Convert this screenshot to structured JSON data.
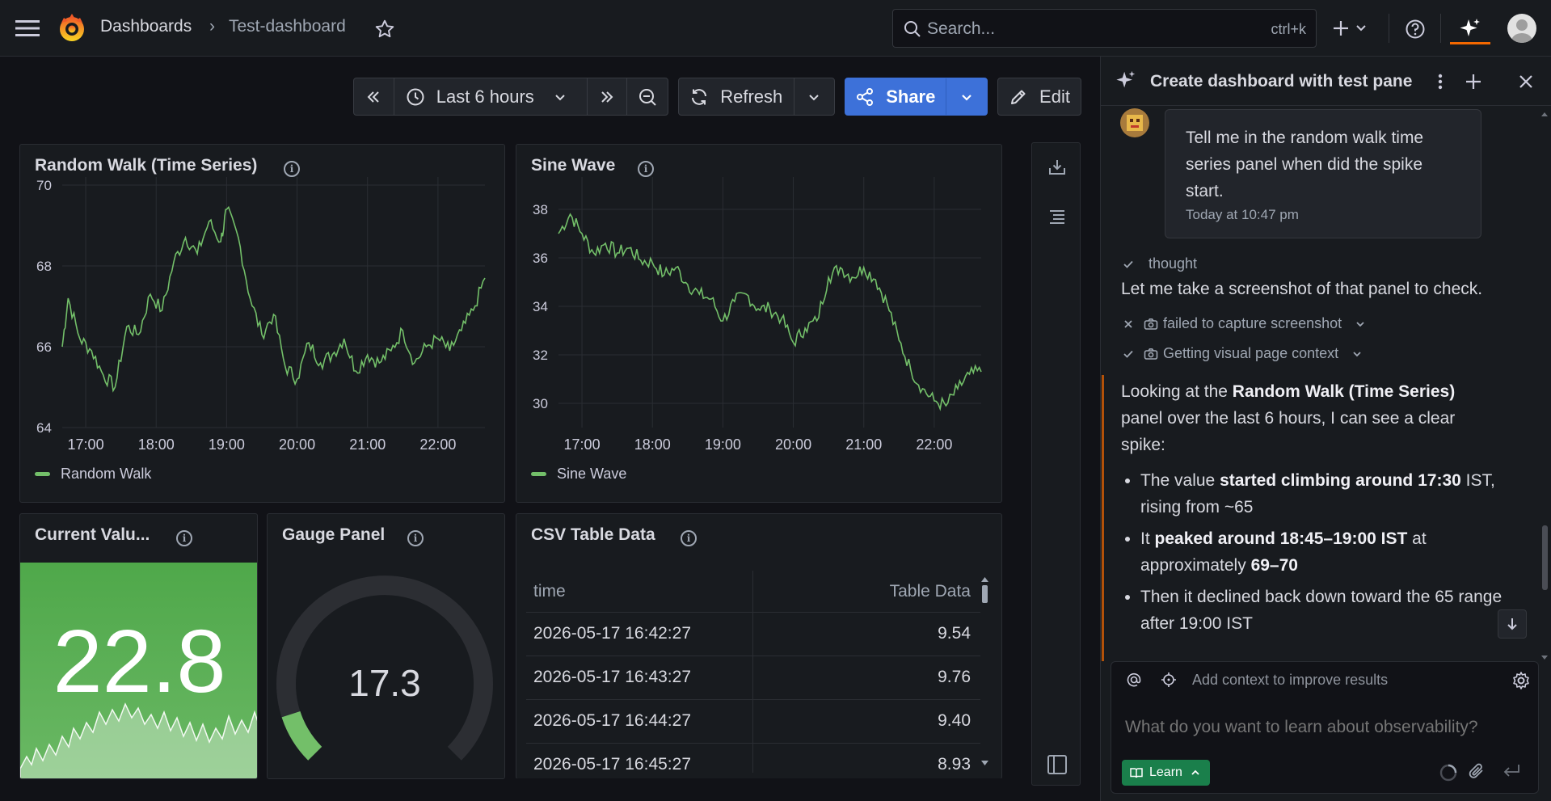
{
  "topbar": {
    "breadcrumb_root": "Dashboards",
    "breadcrumb_sep": "›",
    "breadcrumb_current": "Test-dashboard",
    "search_placeholder": "Search...",
    "search_shortcut": "ctrl+k"
  },
  "toolbar": {
    "time_range": "Last 6 hours",
    "refresh_label": "Refresh",
    "share_label": "Share",
    "edit_label": "Edit"
  },
  "panels": {
    "random_walk": {
      "title": "Random Walk (Time Series)",
      "legend": "Random Walk"
    },
    "sine_wave": {
      "title": "Sine Wave",
      "legend": "Sine Wave"
    },
    "current_value": {
      "title": "Current Valu...",
      "value": "22.8"
    },
    "gauge": {
      "title": "Gauge Panel",
      "value": "17.3",
      "fill_fraction": 0.1
    },
    "csv_table": {
      "title": "CSV Table Data",
      "columns": [
        "time",
        "Table Data"
      ],
      "rows": [
        [
          "2026-05-17 16:42:27",
          "9.54"
        ],
        [
          "2026-05-17 16:43:27",
          "9.76"
        ],
        [
          "2026-05-17 16:44:27",
          "9.40"
        ],
        [
          "2026-05-17 16:45:27",
          "8.93"
        ]
      ]
    }
  },
  "chart_data": [
    {
      "type": "line",
      "title": "Random Walk (Time Series)",
      "x_ticks": [
        "17:00",
        "18:00",
        "19:00",
        "20:00",
        "21:00",
        "22:00"
      ],
      "y_ticks": [
        "70",
        "68",
        "66",
        "64"
      ],
      "ylim": [
        64,
        70
      ],
      "xlim": [
        "16:40",
        "22:40"
      ],
      "grid": true,
      "legend_position": "bottom-left",
      "series": [
        {
          "name": "Random Walk",
          "color": "#73bf69",
          "points": [
            [
              "16:40",
              66.0
            ],
            [
              "16:45",
              67.2
            ],
            [
              "16:55",
              66.2
            ],
            [
              "17:05",
              65.9
            ],
            [
              "17:15",
              65.3
            ],
            [
              "17:25",
              65.0
            ],
            [
              "17:35",
              66.5
            ],
            [
              "17:45",
              66.3
            ],
            [
              "17:55",
              67.3
            ],
            [
              "18:05",
              66.9
            ],
            [
              "18:15",
              68.1
            ],
            [
              "18:25",
              68.7
            ],
            [
              "18:35",
              68.3
            ],
            [
              "18:45",
              69.1
            ],
            [
              "18:55",
              68.6
            ],
            [
              "19:00",
              69.4
            ],
            [
              "19:10",
              68.7
            ],
            [
              "19:20",
              67.2
            ],
            [
              "19:30",
              66.3
            ],
            [
              "19:40",
              66.8
            ],
            [
              "19:50",
              65.5
            ],
            [
              "20:00",
              65.2
            ],
            [
              "20:10",
              66.1
            ],
            [
              "20:20",
              65.6
            ],
            [
              "20:30",
              65.8
            ],
            [
              "20:40",
              66.2
            ],
            [
              "20:50",
              65.4
            ],
            [
              "21:00",
              65.8
            ],
            [
              "21:10",
              65.6
            ],
            [
              "21:20",
              65.9
            ],
            [
              "21:30",
              66.4
            ],
            [
              "21:40",
              65.6
            ],
            [
              "21:50",
              66.0
            ],
            [
              "22:00",
              66.2
            ],
            [
              "22:10",
              65.9
            ],
            [
              "22:20",
              66.4
            ],
            [
              "22:30",
              66.9
            ],
            [
              "22:40",
              67.7
            ]
          ]
        }
      ]
    },
    {
      "type": "line",
      "title": "Sine Wave",
      "x_ticks": [
        "17:00",
        "18:00",
        "19:00",
        "20:00",
        "21:00",
        "22:00"
      ],
      "y_ticks": [
        "38",
        "36",
        "34",
        "32",
        "30"
      ],
      "ylim": [
        29,
        39
      ],
      "xlim": [
        "16:40",
        "22:40"
      ],
      "grid": true,
      "legend_position": "bottom-left",
      "series": [
        {
          "name": "Sine Wave",
          "color": "#73bf69",
          "points": [
            [
              "16:40",
              37.0
            ],
            [
              "16:50",
              37.8
            ],
            [
              "17:00",
              37.0
            ],
            [
              "17:10",
              36.2
            ],
            [
              "17:20",
              36.6
            ],
            [
              "17:30",
              36.2
            ],
            [
              "17:40",
              36.4
            ],
            [
              "17:50",
              35.9
            ],
            [
              "18:00",
              35.8
            ],
            [
              "18:10",
              35.3
            ],
            [
              "18:20",
              35.6
            ],
            [
              "18:30",
              34.9
            ],
            [
              "18:40",
              34.5
            ],
            [
              "18:50",
              34.3
            ],
            [
              "19:00",
              33.4
            ],
            [
              "19:10",
              34.2
            ],
            [
              "19:20",
              34.5
            ],
            [
              "19:30",
              33.9
            ],
            [
              "19:40",
              33.9
            ],
            [
              "19:50",
              33.5
            ],
            [
              "20:00",
              32.5
            ],
            [
              "20:10",
              33.1
            ],
            [
              "20:20",
              33.4
            ],
            [
              "20:30",
              35.2
            ],
            [
              "20:40",
              35.6
            ],
            [
              "20:50",
              35.2
            ],
            [
              "21:00",
              35.6
            ],
            [
              "21:10",
              35.1
            ],
            [
              "21:20",
              34.1
            ],
            [
              "21:30",
              32.6
            ],
            [
              "21:40",
              31.4
            ],
            [
              "21:50",
              30.6
            ],
            [
              "22:00",
              30.1
            ],
            [
              "22:10",
              29.9
            ],
            [
              "22:20",
              30.6
            ],
            [
              "22:30",
              31.2
            ],
            [
              "22:40",
              31.3
            ]
          ]
        }
      ]
    }
  ],
  "assistant": {
    "header_title": "Create dashboard with test pane",
    "user_message": "Tell me in the random walk time series panel when did the spike start.",
    "user_time": "Today at 10:47 pm",
    "step_thought": "thought",
    "thought_text": "Let me take a screenshot of that panel to check.",
    "step_failed": "failed to capture screenshot",
    "step_context": "Getting visual page context",
    "answer_pre": "Looking at the ",
    "answer_bold": "Random Walk (Time Series)",
    "answer_post": " panel over the last 6 hours, I can see a clear spike:",
    "bullets": [
      {
        "a": "The value ",
        "b": "started climbing around 17:30",
        "c": " IST, rising from ~65",
        "d": "",
        "e": ""
      },
      {
        "a": "It ",
        "b": "peaked around 18:45–19:00 IST",
        "c": " at approximately ",
        "d": "69–70",
        "e": ""
      },
      {
        "a": "Then it declined back down toward the 65 range after 19:00 IST",
        "b": "",
        "c": "",
        "d": "",
        "e": ""
      }
    ],
    "context_label": "Add context to improve results",
    "input_placeholder": "What do you want to learn about observability?",
    "learn_label": "Learn"
  },
  "colors": {
    "series": "#73bf69",
    "accent": "#3d71d9",
    "stat_bg": "#56a64b",
    "learn_bg": "#1a7f4b"
  }
}
